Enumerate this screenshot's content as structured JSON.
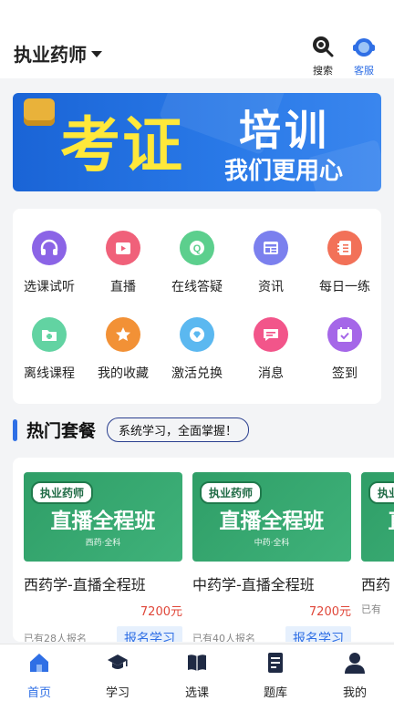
{
  "header": {
    "title": "执业药师",
    "search_label": "搜索",
    "service_label": "客服",
    "service_color": "#2f6fe5"
  },
  "banner": {
    "text_main": "考证",
    "text_top": "培训",
    "text_sub": "我们更用心"
  },
  "menu": [
    {
      "label": "选课试听",
      "icon": "headphones-icon",
      "color": "#8b64e6"
    },
    {
      "label": "直播",
      "icon": "video-icon",
      "color": "#f0617a"
    },
    {
      "label": "在线答疑",
      "icon": "question-icon",
      "color": "#5ccf8d"
    },
    {
      "label": "资讯",
      "icon": "news-icon",
      "color": "#7b80ee"
    },
    {
      "label": "每日一练",
      "icon": "notebook-icon",
      "color": "#f27158"
    },
    {
      "label": "离线课程",
      "icon": "folder-icon",
      "color": "#62d3a2"
    },
    {
      "label": "我的收藏",
      "icon": "star-icon",
      "color": "#f29136"
    },
    {
      "label": "激活兑换",
      "icon": "diamond-icon",
      "color": "#5bb8f0"
    },
    {
      "label": "消息",
      "icon": "message-icon",
      "color": "#f2558a"
    },
    {
      "label": "签到",
      "icon": "calendar-check-icon",
      "color": "#a567e8"
    }
  ],
  "section": {
    "title": "热门套餐",
    "tag": "系统学习，全面掌握！"
  },
  "courses": [
    {
      "badge": "执业药师",
      "cover_title": "直播全程班",
      "cover_sub": "西药·全科",
      "name": "西药学-直播全程班",
      "price": "7200元",
      "count": "已有28人报名",
      "button": "报名学习"
    },
    {
      "badge": "执业药师",
      "cover_title": "直播全程班",
      "cover_sub": "中药·全科",
      "name": "中药学-直播全程班",
      "price": "7200元",
      "count": "已有40人报名",
      "button": "报名学习"
    },
    {
      "badge": "执业药师",
      "cover_title": "直播全程班",
      "cover_sub": "",
      "name": "西药",
      "price": "",
      "count": "已有",
      "button": ""
    }
  ],
  "tabs": [
    {
      "label": "首页",
      "icon": "home-icon"
    },
    {
      "label": "学习",
      "icon": "graduation-cap-icon"
    },
    {
      "label": "选课",
      "icon": "book-icon"
    },
    {
      "label": "题库",
      "icon": "document-icon"
    },
    {
      "label": "我的",
      "icon": "user-icon"
    }
  ],
  "colors": {
    "accent": "#2f6fe5",
    "price": "#e0473a"
  }
}
